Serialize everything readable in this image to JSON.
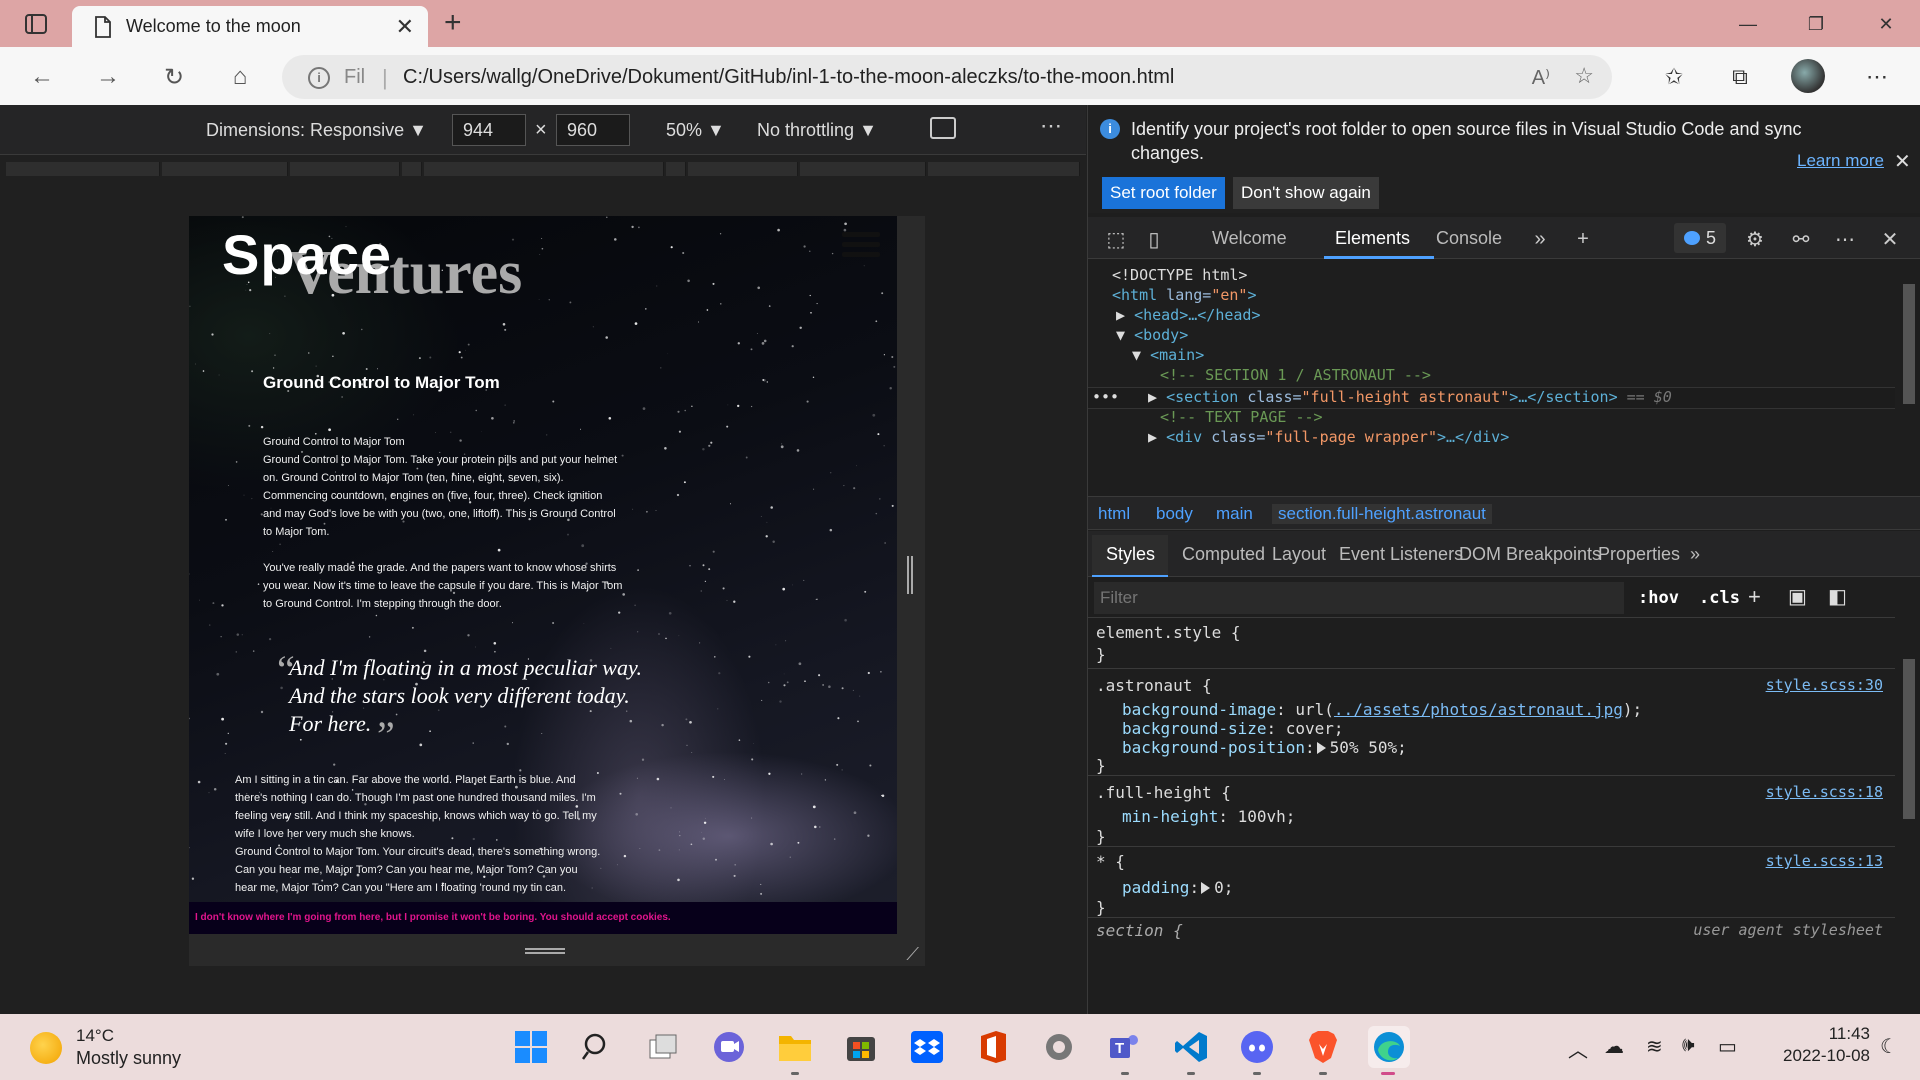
{
  "browser": {
    "tab_title": "Welcome to the moon",
    "url_scheme": "Fil",
    "url": "C:/Users/wallg/OneDrive/Dokument/GitHub/inl-1-to-the-moon-aleczks/to-the-moon.html",
    "read_aloud_label": "A⁾"
  },
  "device_toolbar": {
    "dimensions_label": "Dimensions: Responsive",
    "width": "944",
    "height": "960",
    "times": "×",
    "zoom": "50%",
    "throttling": "No throttling",
    "more": "⋯"
  },
  "preview": {
    "title_line1": "Space",
    "title_line2": "Ventures",
    "heading": "Ground Control to Major Tom",
    "para1": "Ground Control to Major Tom\nGround Control to Major Tom. Take your protein pills and put your helmet\non. Ground Control to Major Tom (ten, nine, eight, seven, six).\nCommencing countdown, engines on (five, four, three). Check ignition\nand may God's love be with you (two, one, liftoff). This is Ground Control\nto Major Tom.",
    "para2": "You've really made the grade. And the papers want to know whose shirts\nyou wear. Now it's time to leave the capsule if you dare. This is Major Tom\nto Ground Control. I'm stepping through the door.",
    "quote": "And I'm floating in a most peculiar way.\nAnd the stars look very different today.\nFor here.",
    "quote_open": "“",
    "quote_close": "”",
    "para3": "Am I sitting in a tin can. Far above the world. Planet Earth is blue. And\nthere's nothing I can do. Though I'm past one hundred thousand miles. I'm\nfeeling very still. And I think my spaceship, knows which way to go. Tell my\nwife I love her very much she knows.\nGround Control to Major Tom. Your circuit's dead, there's something wrong.\nCan you hear me, Major Tom? Can you hear me, Major Tom? Can you\nhear me, Major Tom? Can you \"Here am I floating 'round my tin can.",
    "cookie_banner": "I don't know where I'm going from here, but I promise it won't be boring. You should accept cookies."
  },
  "devtools": {
    "info_message": "Identify your project's root folder to open source files in Visual Studio Code and sync changes.",
    "learn_more": "Learn more",
    "set_root_button": "Set root folder",
    "dont_show_button": "Don't show again",
    "tabs": [
      "Welcome",
      "Elements",
      "Console"
    ],
    "issues_count": "5",
    "dom_lines": {
      "doctype": "<!DOCTYPE html>",
      "html_tag": "<html",
      "html_attr": " lang=",
      "html_val": "\"en\"",
      "html_close": ">",
      "head": "<head>…</head>",
      "body": "<body>",
      "main": "<main>",
      "comment1": "<!-- SECTION 1 / ASTRONAUT -->",
      "section_tag": "<section",
      "section_attr": " class=",
      "section_val": "\"full-height astronaut\"",
      "section_close": ">…</section>",
      "section_eq": " == $0",
      "comment2": "<!-- TEXT PAGE -->",
      "div_tag": "<div",
      "div_attr": " class=",
      "div_val": "\"full-page wrapper\"",
      "div_close": ">…</div>",
      "dots": "•••"
    },
    "breadcrumbs": [
      "html",
      "body",
      "main",
      "section.full-height.astronaut"
    ],
    "subtabs": [
      "Styles",
      "Computed",
      "Layout",
      "Event Listeners",
      "DOM Breakpoints",
      "Properties"
    ],
    "filter_placeholder": "Filter",
    "hov": ":hov",
    "cls": ".cls",
    "rules": {
      "element_style_open": "element.style {",
      "close_brace": "}",
      "astronaut_selector": ".astronaut {",
      "astronaut_source": "style.scss:30",
      "bg_image_name": "background-image",
      "bg_image_prefix": ": url(",
      "bg_image_link": "../assets/photos/astronaut.jpg",
      "bg_image_suffix": ");",
      "bg_size_name": "background-size",
      "bg_size_val": ": cover;",
      "bg_pos_name": "background-position",
      "bg_pos_colon": ":",
      "bg_pos_val": "50% 50%;",
      "full_height_selector": ".full-height {",
      "full_height_source": "style.scss:18",
      "min_height_name": "min-height",
      "min_height_val": ": 100vh;",
      "star_selector": "* {",
      "star_source": "style.scss:13",
      "padding_name": "padding",
      "padding_colon": ":",
      "padding_val": "0;",
      "section_selector": "section {",
      "section_source": "user agent stylesheet"
    }
  },
  "taskbar": {
    "temperature": "14°C",
    "condition": "Mostly sunny",
    "time": "11:43",
    "date": "2022-10-08"
  },
  "colors": {
    "titlebar": "#dda5a5",
    "accent": "#1a73d9",
    "cookie_text": "#e0148c"
  }
}
